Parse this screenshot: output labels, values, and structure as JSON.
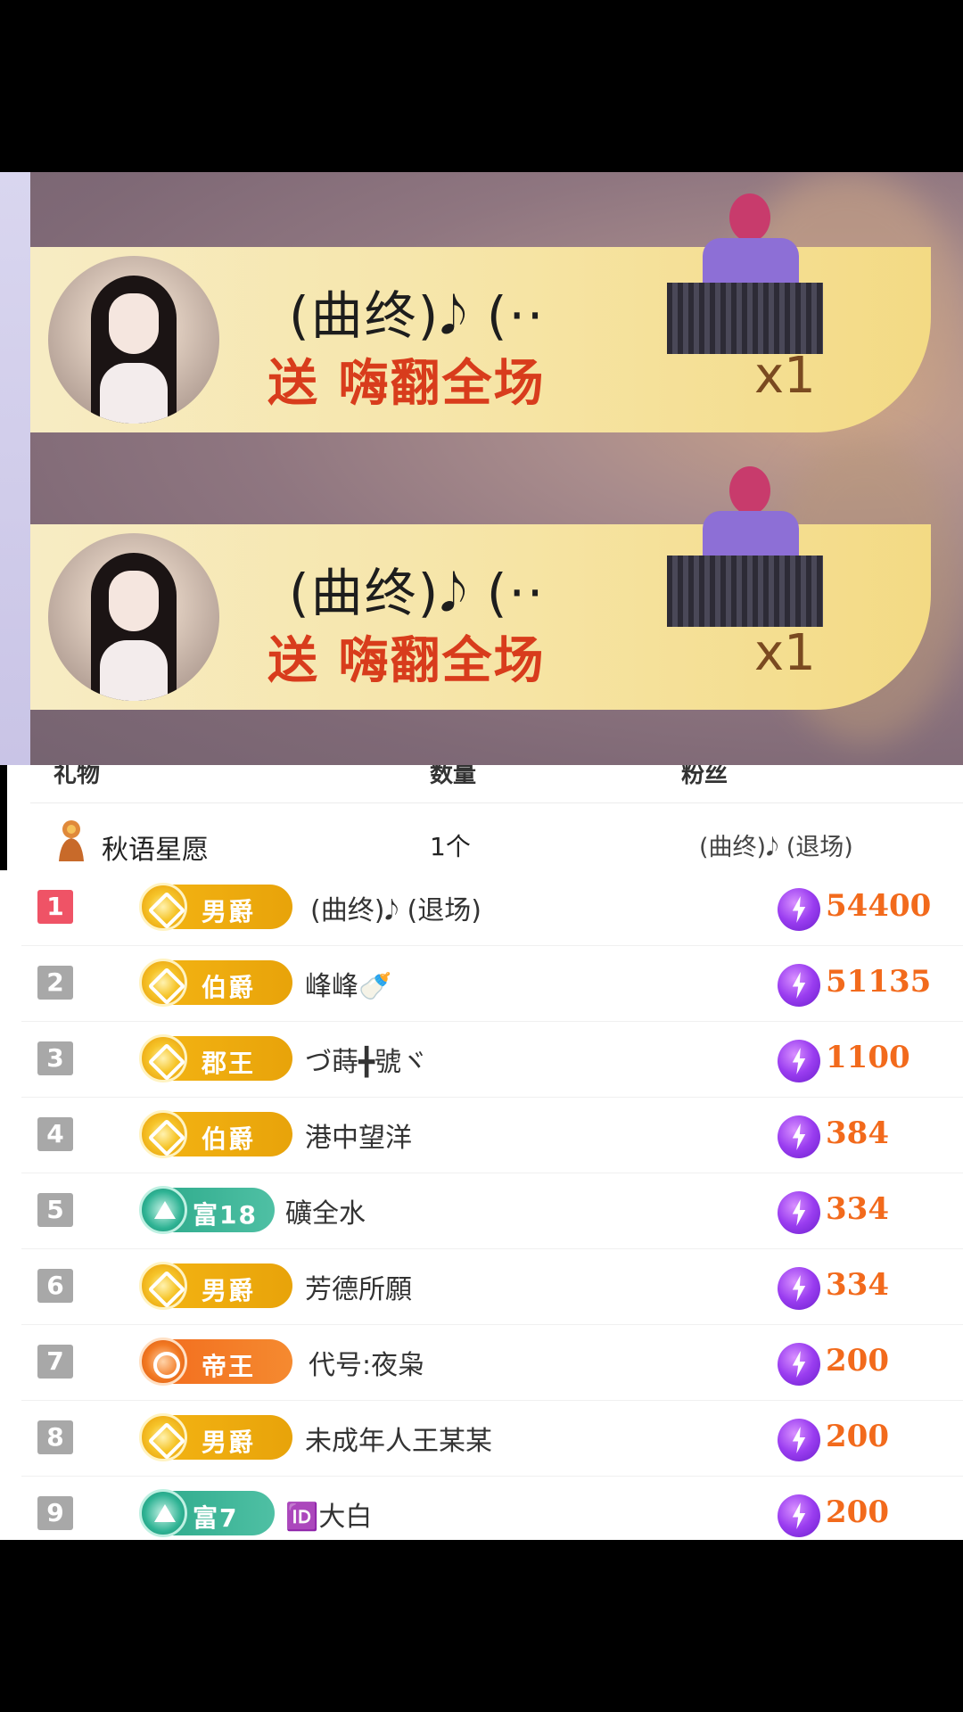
{
  "gift_banners": [
    {
      "sender": "(曲终)𝅘𝅥𝅮 (··",
      "action": "送",
      "gift": "嗨翻全场",
      "count": "x1"
    },
    {
      "sender": "(曲终)𝅘𝅥𝅮 (··",
      "action": "送",
      "gift": "嗨翻全场",
      "count": "x1"
    }
  ],
  "gift_table": {
    "headers": [
      "礼物",
      "数量",
      "粉丝"
    ],
    "row": {
      "gift": "秋语星愿",
      "qty": "1个",
      "from": "(曲终)𝅘𝅥𝅮 (退场)"
    }
  },
  "ranking": [
    {
      "rank": "1",
      "badge": "男爵",
      "badge_style": "gold",
      "name": "(曲终)𝅘𝅥𝅮 (退场)",
      "score": "54400"
    },
    {
      "rank": "2",
      "badge": "伯爵",
      "badge_style": "gold",
      "name": "峰峰🍼",
      "score": "51135"
    },
    {
      "rank": "3",
      "badge": "郡王",
      "badge_style": "gold",
      "name": "づ蒔╋號ヾ",
      "score": "1100"
    },
    {
      "rank": "4",
      "badge": "伯爵",
      "badge_style": "gold",
      "name": "港中望洋",
      "score": "384"
    },
    {
      "rank": "5",
      "badge": "富18",
      "badge_style": "green",
      "name": "礦全水",
      "score": "334"
    },
    {
      "rank": "6",
      "badge": "男爵",
      "badge_style": "gold",
      "name": "芳德所願",
      "score": "334"
    },
    {
      "rank": "7",
      "badge": "帝王",
      "badge_style": "orange",
      "name": "代号:夜枭",
      "score": "200"
    },
    {
      "rank": "8",
      "badge": "男爵",
      "badge_style": "gold",
      "name": "未成年人王某某",
      "score": "200"
    },
    {
      "rank": "9",
      "badge": "富7",
      "badge_style": "green",
      "name": "🆔大白",
      "score": "200"
    }
  ],
  "colors": {
    "rank_first": "#ef5366",
    "score": "#f26a1c",
    "gift_text": "#d83c1c"
  },
  "icons": {
    "currency": "lightning-coin-icon",
    "gift": "gift-statue-icon"
  }
}
